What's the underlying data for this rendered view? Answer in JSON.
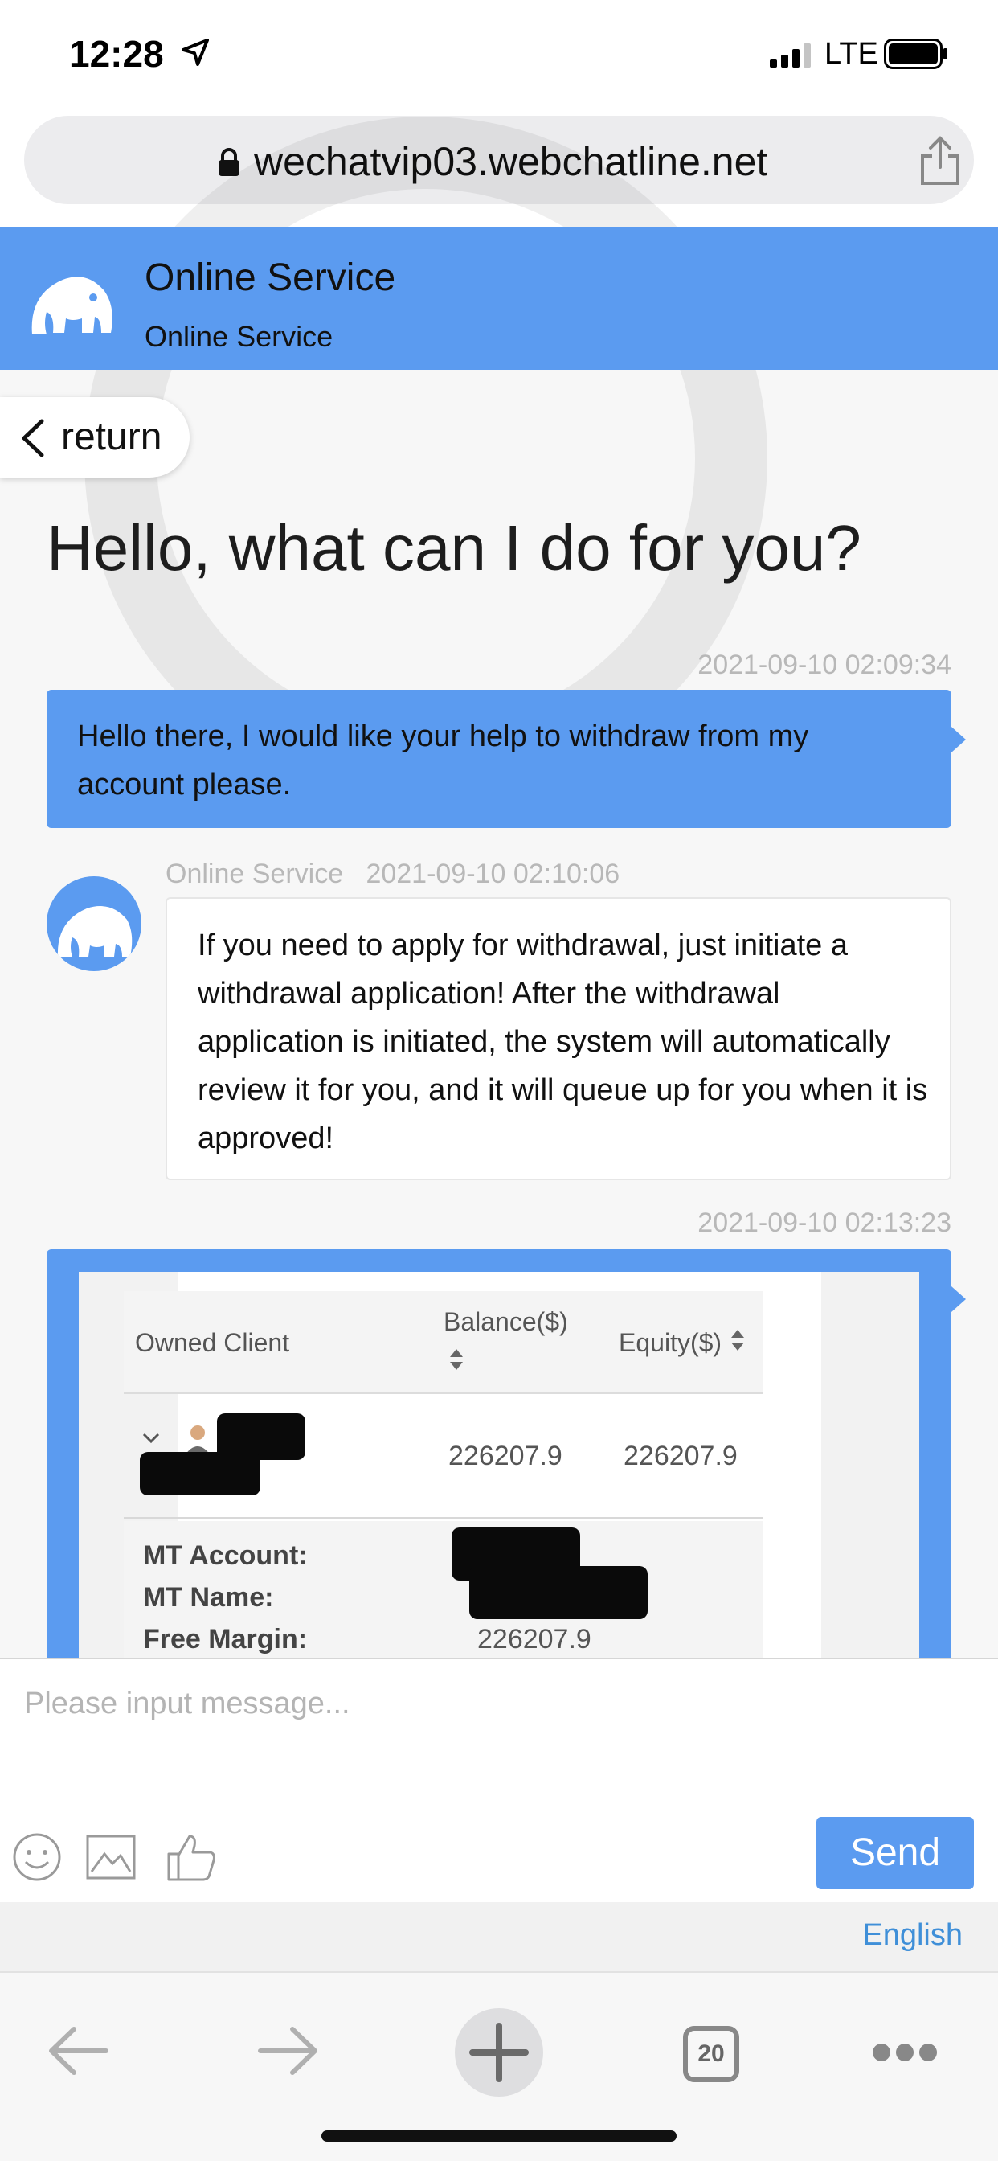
{
  "status_bar": {
    "time": "12:28",
    "network": "LTE"
  },
  "browser": {
    "url": "wechatvip03.webchatline.net",
    "tabs_count": "20"
  },
  "header": {
    "title": "Online Service",
    "subtitle": "Online Service"
  },
  "return_label": "return",
  "greeting": "Hello, what can I do for you?",
  "messages": [
    {
      "timestamp": "2021-09-10 02:09:34",
      "text": "Hello there, I would like your help to withdraw from my account please."
    },
    {
      "sender": "Online Service",
      "timestamp": "2021-09-10 02:10:06",
      "text": "If you need to apply for withdrawal, just initiate a withdrawal application! After the withdrawal application is initiated, the system will automatically review it for you, and it will queue up for you when it is approved!"
    },
    {
      "timestamp": "2021-09-10 02:13:23"
    }
  ],
  "screenshot_table": {
    "headers": [
      "Owned Client",
      "Balance($)",
      "Equity($)"
    ],
    "row": {
      "balance": "226207.9",
      "equity": "226207.9"
    },
    "details": {
      "mt_account_label": "MT Account:",
      "mt_name_label": "MT Name:",
      "free_margin_label": "Free Margin:",
      "free_margin_value": "226207.9"
    }
  },
  "composer": {
    "placeholder": "Please input message...",
    "send_label": "Send",
    "language": "English"
  },
  "colors": {
    "accent": "#5b9bf0",
    "link": "#3f8fd8"
  },
  "icons": [
    "location-arrow-icon",
    "signal-icon",
    "battery-icon",
    "lock-icon",
    "share-icon",
    "elephant-logo-icon",
    "chevron-left-icon",
    "sort-icon",
    "emoji-icon",
    "image-icon",
    "thumbs-up-icon",
    "back-arrow-icon",
    "forward-arrow-icon",
    "new-tab-plus-icon",
    "more-icon"
  ]
}
